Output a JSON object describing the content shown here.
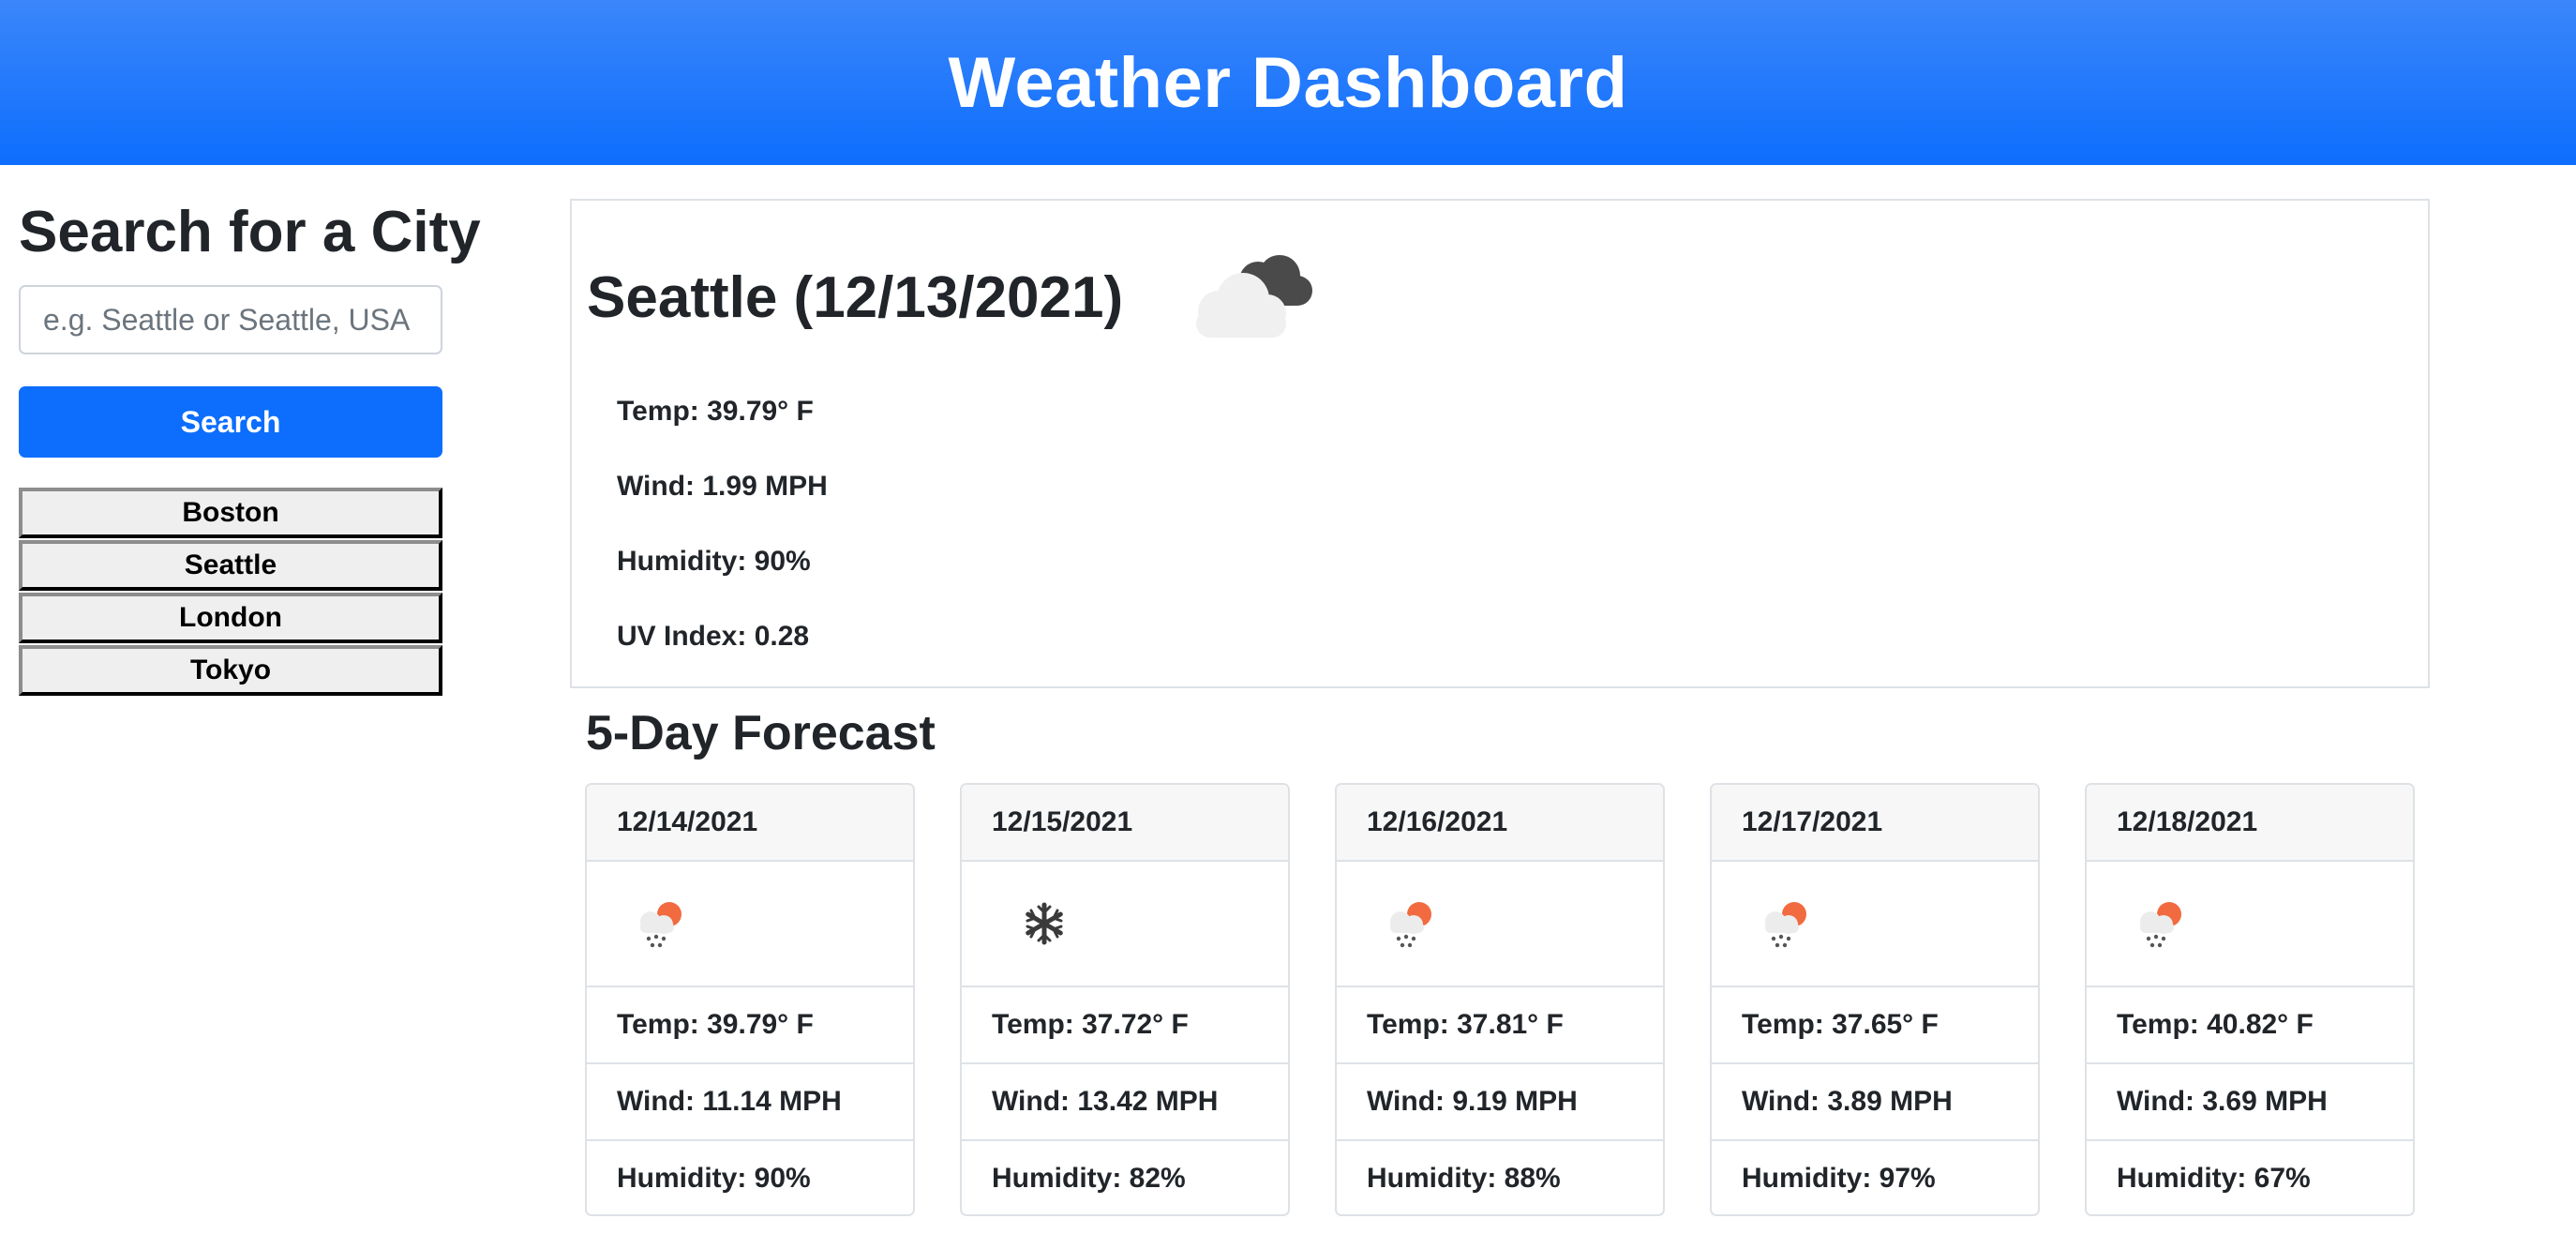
{
  "header": {
    "title": "Weather Dashboard"
  },
  "search": {
    "title": "Search for a City",
    "placeholder": "e.g. Seattle or Seattle, USA",
    "button_label": "Search",
    "history": [
      "Boston",
      "Seattle",
      "London",
      "Tokyo"
    ]
  },
  "current": {
    "title": "Seattle (12/13/2021)",
    "icon": "broken-clouds-icon",
    "temp": "Temp: 39.79° F",
    "wind": "Wind: 1.99 MPH",
    "humidity": "Humidity: 90%",
    "uv": "UV Index: 0.28"
  },
  "forecast": {
    "title": "5-Day Forecast",
    "days": [
      {
        "date": "12/14/2021",
        "icon": "light-snow-icon",
        "temp": "Temp: 39.79° F",
        "wind": "Wind: 11.14 MPH",
        "humidity": "Humidity: 90%"
      },
      {
        "date": "12/15/2021",
        "icon": "snowflake-icon",
        "temp": "Temp: 37.72° F",
        "wind": "Wind: 13.42 MPH",
        "humidity": "Humidity: 82%"
      },
      {
        "date": "12/16/2021",
        "icon": "light-snow-icon",
        "temp": "Temp: 37.81° F",
        "wind": "Wind: 9.19 MPH",
        "humidity": "Humidity: 88%"
      },
      {
        "date": "12/17/2021",
        "icon": "light-snow-icon",
        "temp": "Temp: 37.65° F",
        "wind": "Wind: 3.89 MPH",
        "humidity": "Humidity: 97%"
      },
      {
        "date": "12/18/2021",
        "icon": "light-snow-icon",
        "temp": "Temp: 40.82° F",
        "wind": "Wind: 3.69 MPH",
        "humidity": "Humidity: 67%"
      }
    ]
  },
  "colors": {
    "primary": "#0d6efd",
    "sun": "#f26a3f"
  }
}
